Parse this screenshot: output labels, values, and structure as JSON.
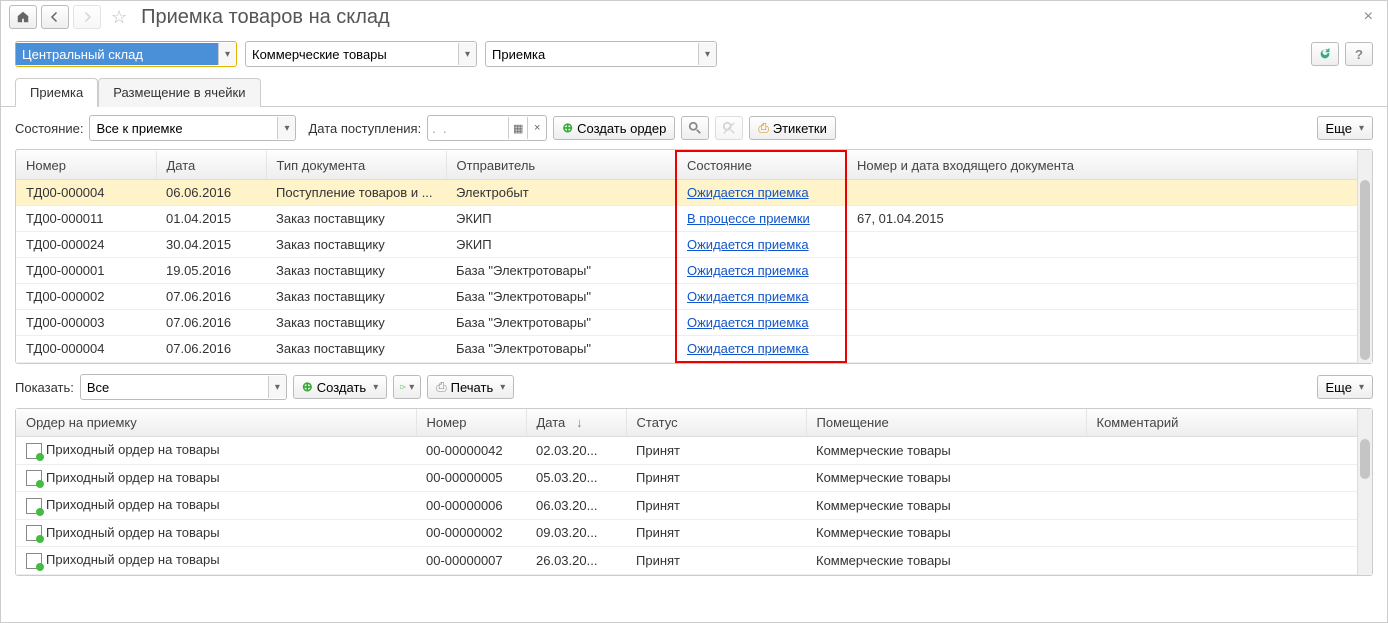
{
  "header": {
    "title": "Приемка товаров на склад"
  },
  "filters": {
    "warehouse": "Центральный склад",
    "goods_type": "Коммерческие товары",
    "operation": "Приемка"
  },
  "tabs": {
    "t1": "Приемка",
    "t2": "Размещение в ячейки"
  },
  "toolbar": {
    "state_label": "Состояние:",
    "state_value": "Все к приемке",
    "date_label": "Дата поступления:",
    "date_value": ".  .",
    "create_order": "Создать ордер",
    "labels": "Этикетки",
    "more": "Еще"
  },
  "table1": {
    "cols": {
      "num": "Номер",
      "date": "Дата",
      "type": "Тип документа",
      "sender": "Отправитель",
      "state": "Состояние",
      "incoming": "Номер и дата входящего документа"
    },
    "rows": [
      {
        "num": "ТД00-000004",
        "date": "06.06.2016",
        "type": "Поступление товаров и ...",
        "sender": "Электробыт",
        "state": "Ожидается приемка",
        "incoming": "",
        "sel": true
      },
      {
        "num": "ТД00-000011",
        "date": "01.04.2015",
        "type": "Заказ поставщику",
        "sender": "ЭКИП",
        "state": "В процессе приемки",
        "incoming": "67, 01.04.2015"
      },
      {
        "num": "ТД00-000024",
        "date": "30.04.2015",
        "type": "Заказ поставщику",
        "sender": "ЭКИП",
        "state": "Ожидается приемка",
        "incoming": ""
      },
      {
        "num": "ТД00-000001",
        "date": "19.05.2016",
        "type": "Заказ поставщику",
        "sender": "База \"Электротовары\"",
        "state": "Ожидается приемка",
        "incoming": ""
      },
      {
        "num": "ТД00-000002",
        "date": "07.06.2016",
        "type": "Заказ поставщику",
        "sender": "База \"Электротовары\"",
        "state": "Ожидается приемка",
        "incoming": ""
      },
      {
        "num": "ТД00-000003",
        "date": "07.06.2016",
        "type": "Заказ поставщику",
        "sender": "База \"Электротовары\"",
        "state": "Ожидается приемка",
        "incoming": ""
      },
      {
        "num": "ТД00-000004",
        "date": "07.06.2016",
        "type": "Заказ поставщику",
        "sender": "База \"Электротовары\"",
        "state": "Ожидается приемка",
        "incoming": ""
      }
    ]
  },
  "sub": {
    "show_label": "Показать:",
    "show_value": "Все",
    "create": "Создать",
    "print": "Печать",
    "more": "Еще"
  },
  "table2": {
    "cols": {
      "order": "Ордер на приемку",
      "num": "Номер",
      "date": "Дата",
      "status": "Статус",
      "room": "Помещение",
      "comment": "Комментарий"
    },
    "rows": [
      {
        "order": "Приходный ордер на товары",
        "num": "00-00000042",
        "date": "02.03.20...",
        "status": "Принят",
        "room": "Коммерческие товары",
        "comment": ""
      },
      {
        "order": "Приходный ордер на товары",
        "num": "00-00000005",
        "date": "05.03.20...",
        "status": "Принят",
        "room": "Коммерческие товары",
        "comment": ""
      },
      {
        "order": "Приходный ордер на товары",
        "num": "00-00000006",
        "date": "06.03.20...",
        "status": "Принят",
        "room": "Коммерческие товары",
        "comment": ""
      },
      {
        "order": "Приходный ордер на товары",
        "num": "00-00000002",
        "date": "09.03.20...",
        "status": "Принят",
        "room": "Коммерческие товары",
        "comment": ""
      },
      {
        "order": "Приходный ордер на товары",
        "num": "00-00000007",
        "date": "26.03.20...",
        "status": "Принят",
        "room": "Коммерческие товары",
        "comment": ""
      }
    ]
  }
}
